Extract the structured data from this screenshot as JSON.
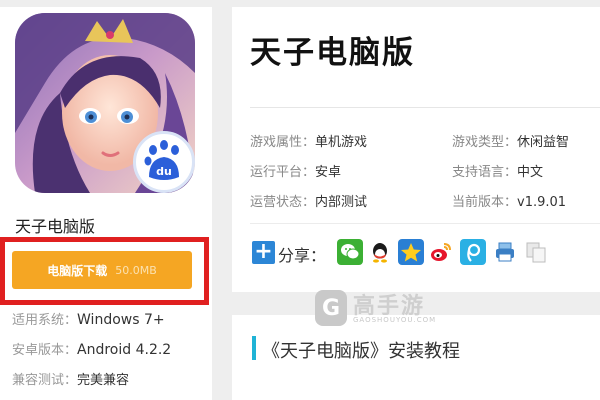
{
  "left": {
    "app_name": "天子电脑版",
    "download_label": "电脑版下载",
    "download_size": "50.0MB",
    "badge_text": "du",
    "specs": [
      {
        "key": "适用系统：",
        "value": "Windows 7+"
      },
      {
        "key": "安卓版本：",
        "value": "Android 4.2.2"
      },
      {
        "key": "兼容测试：",
        "value": "完美兼容"
      }
    ]
  },
  "main": {
    "title": "天子电脑版",
    "attributes": [
      {
        "key": "游戏属性：",
        "value": "单机游戏"
      },
      {
        "key": "游戏类型：",
        "value": "休闲益智"
      },
      {
        "key": "运行平台：",
        "value": "安卓"
      },
      {
        "key": "支持语言：",
        "value": "中文"
      },
      {
        "key": "运营状态：",
        "value": "内部测试"
      },
      {
        "key": "当前版本：",
        "value": "v1.9.01"
      }
    ],
    "share_label": "分享：",
    "share_plus": "+",
    "tutorial_title": "《天子电脑版》安装教程"
  },
  "watermark": {
    "logo_glyph": "G",
    "name": "高手游",
    "domain": "GAOSHOUYOU.COM"
  },
  "colors": {
    "download_button": "#f5a623",
    "highlight_frame": "#e02020",
    "share_plus": "#2c86d6",
    "tutorial_bar": "#1fb3d6"
  },
  "icons": {
    "share": [
      "wechat-icon",
      "qq-icon",
      "qzone-icon",
      "weibo-icon",
      "tencent-weibo-icon",
      "print-icon",
      "copy-icon"
    ]
  }
}
